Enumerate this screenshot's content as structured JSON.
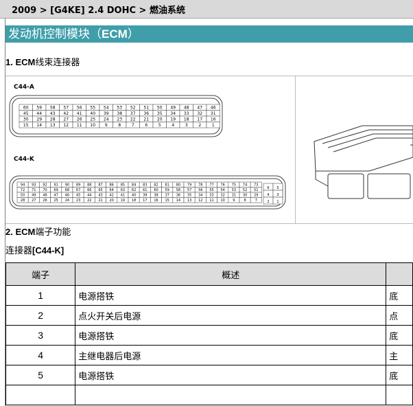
{
  "breadcrumb": "2009 > [G4KE] 2.4 DOHC > 燃油系统",
  "banner": {
    "text": "发动机控制模块（",
    "bold": "ECM",
    "tail": "）"
  },
  "section1": {
    "num": "1. ",
    "bold": "ECM",
    "text": "线束连接器"
  },
  "figure": {
    "connA": {
      "label": "C44-A",
      "rows": [
        [
          "60",
          "59",
          "58",
          "57",
          "56",
          "55",
          "54",
          "53",
          "52",
          "51",
          "50",
          "49",
          "48",
          "47",
          "46"
        ],
        [
          "45",
          "44",
          "43",
          "42",
          "41",
          "40",
          "39",
          "38",
          "37",
          "36",
          "35",
          "34",
          "33",
          "32",
          "31"
        ],
        [
          "30",
          "29",
          "28",
          "27",
          "26",
          "25",
          "24",
          "23",
          "22",
          "21",
          "20",
          "19",
          "18",
          "17",
          "16"
        ],
        [
          "15",
          "14",
          "13",
          "12",
          "11",
          "10",
          "9",
          "8",
          "7",
          "6",
          "5",
          "4",
          "3",
          "2",
          "1"
        ]
      ]
    },
    "connK": {
      "label": "C44-K",
      "rows": [
        [
          "94",
          "93",
          "92",
          "91",
          "90",
          "89",
          "88",
          "87",
          "86",
          "85",
          "84",
          "83",
          "82",
          "81",
          "80",
          "79",
          "78",
          "77",
          "76",
          "75",
          "74",
          "73"
        ],
        [
          "72",
          "71",
          "70",
          "69",
          "68",
          "67",
          "66",
          "65",
          "64",
          "63",
          "62",
          "61",
          "60",
          "59",
          "58",
          "57",
          "56",
          "55",
          "54",
          "53",
          "52",
          "51"
        ],
        [
          "50",
          "49",
          "48",
          "47",
          "46",
          "45",
          "44",
          "43",
          "42",
          "41",
          "40",
          "39",
          "38",
          "37",
          "36",
          "35",
          "34",
          "33",
          "32",
          "31",
          "30",
          "29"
        ],
        [
          "28",
          "27",
          "26",
          "25",
          "24",
          "23",
          "22",
          "21",
          "20",
          "19",
          "18",
          "17",
          "16",
          "15",
          "14",
          "13",
          "12",
          "11",
          "10",
          "9",
          "8",
          "7"
        ]
      ],
      "side": [
        [
          "6",
          "5"
        ],
        [
          "4",
          "3"
        ],
        [
          "2",
          "1"
        ]
      ]
    }
  },
  "section2": {
    "num": "2. ",
    "bold": "ECM",
    "text": "端子功能"
  },
  "connector": {
    "text": "连接器",
    "bold": "[C44-K]"
  },
  "table": {
    "headers": [
      "端子",
      "概述",
      ""
    ],
    "rows": [
      {
        "pin": "1",
        "desc": "电源搭铁",
        "extra": "底"
      },
      {
        "pin": "2",
        "desc": "点火开关后电源",
        "extra": "点"
      },
      {
        "pin": "3",
        "desc": "电源搭铁",
        "extra": "底"
      },
      {
        "pin": "4",
        "desc": "主继电器后电源",
        "extra": "主"
      },
      {
        "pin": "5",
        "desc": "电源搭铁",
        "extra": "底"
      },
      {
        "pin": "",
        "desc": "",
        "extra": ""
      }
    ]
  }
}
